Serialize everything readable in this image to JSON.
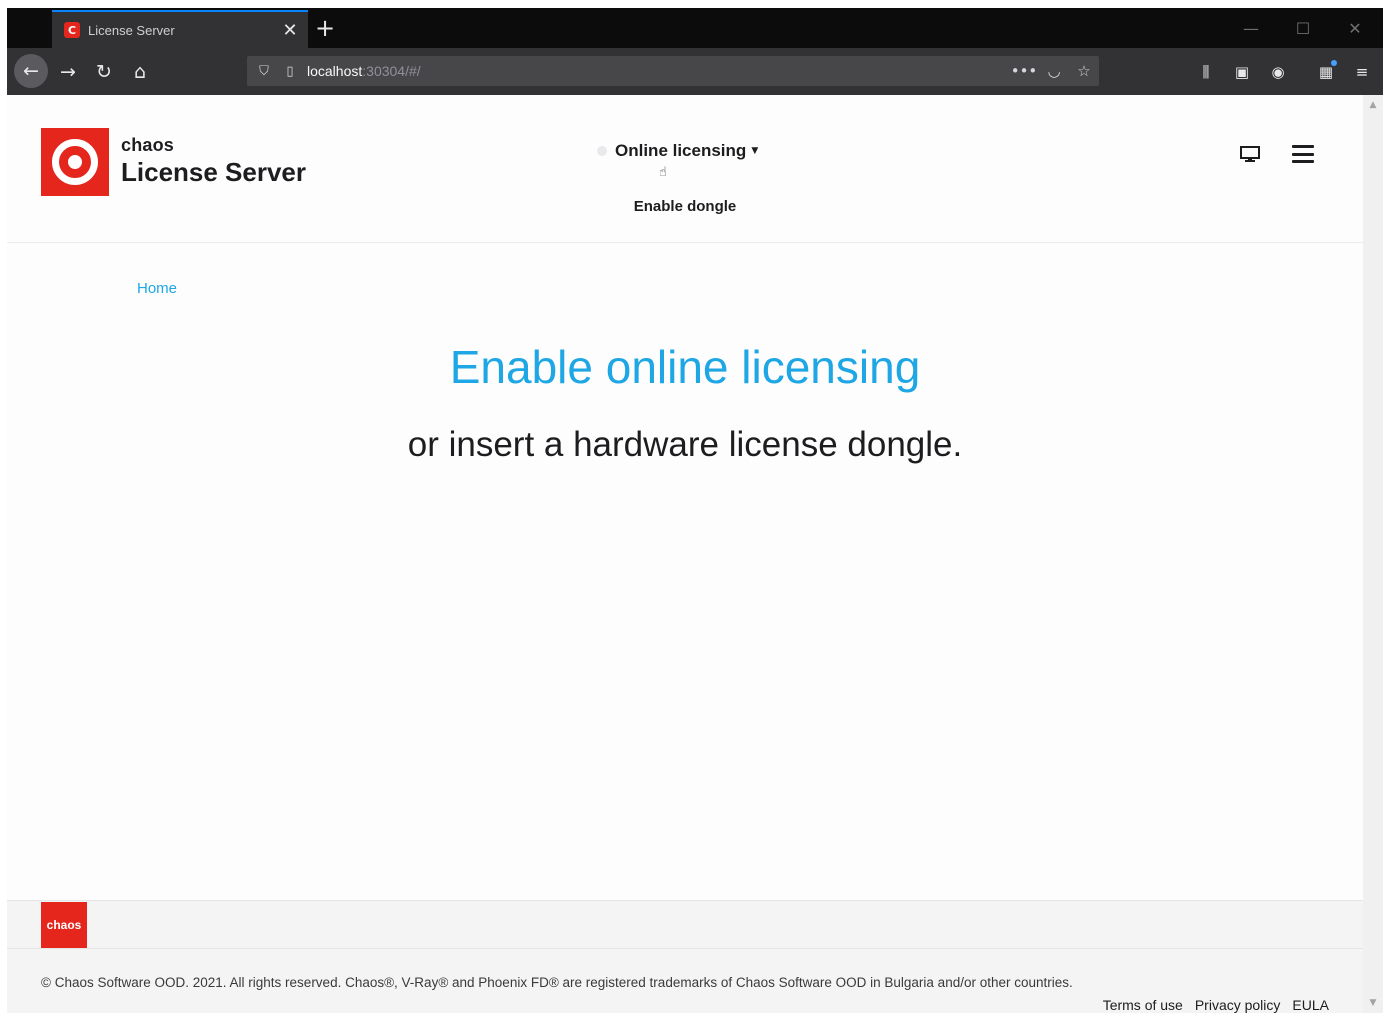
{
  "browser": {
    "tab_title": "License Server",
    "tab_favicon": "C",
    "tab_close": "✕",
    "new_tab": "+",
    "url_host": "localhost",
    "url_rest": ":30304/#/",
    "win_minimize": "—",
    "win_maximize": "☐",
    "win_close": "✕",
    "accent_color": "#0a84ff"
  },
  "header": {
    "brand_small": "chaos",
    "brand_big": "License Server",
    "mode_label": "Online licensing",
    "dongle_link": "Enable dongle",
    "icons": [
      "monitor-icon",
      "hamburger-menu-icon"
    ]
  },
  "breadcrumb": {
    "home": "Home"
  },
  "hero": {
    "title": "Enable online licensing",
    "subtitle": "or insert a hardware license dongle.",
    "accent_color": "#1ea7e4"
  },
  "footer": {
    "logo_text": "chaos",
    "copyright": "© Chaos Software OOD. 2021. All rights reserved. Chaos®, V-Ray® and Phoenix FD® are registered trademarks of Chaos Software OOD in Bulgaria and/or other countries.",
    "links": [
      "Terms of use",
      "Privacy policy",
      "EULA"
    ],
    "brand_color": "#e4261d"
  }
}
